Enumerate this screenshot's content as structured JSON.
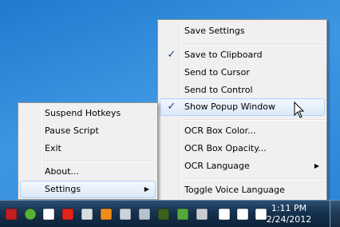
{
  "settings_menu": {
    "items": [
      {
        "label": "Save Settings",
        "checked": false
      },
      {
        "label": "Save to Clipboard",
        "checked": true
      },
      {
        "label": "Send to Cursor",
        "checked": false
      },
      {
        "label": "Send to Control",
        "checked": false
      },
      {
        "label": "Show Popup Window",
        "checked": true,
        "hovered": true
      },
      {
        "label": "OCR Box Color...",
        "checked": false
      },
      {
        "label": "OCR Box Opacity...",
        "checked": false
      },
      {
        "label": "OCR Language",
        "checked": false,
        "has_submenu": true
      },
      {
        "label": "Toggle Voice Language",
        "checked": false
      }
    ],
    "check_glyph": "✓",
    "arrow_glyph": "▶"
  },
  "script_menu": {
    "items": [
      {
        "label": "Suspend Hotkeys"
      },
      {
        "label": "Pause Script"
      },
      {
        "label": "Exit"
      },
      {
        "label": "About..."
      },
      {
        "label": "Settings",
        "has_submenu": true,
        "hovered": true
      }
    ]
  },
  "taskbar": {
    "clock_time": "1:11 PM",
    "clock_date": "2/24/2012",
    "tray_icons": [
      {
        "name": "autohotkey-tray-icon",
        "color": "#c21d24"
      },
      {
        "name": "utorrent-tray-icon",
        "color": "#57b337"
      },
      {
        "name": "windows-flag-tray-icon",
        "color": "#ffffff"
      },
      {
        "name": "red-stop-tray-icon",
        "color": "#e2231a"
      },
      {
        "name": "gmail-tray-icon",
        "color": "#d8dde3"
      },
      {
        "name": "orange-box-tray-icon",
        "color": "#f18b1c"
      },
      {
        "name": "email-tray-icon",
        "color": "#c9d3de"
      },
      {
        "name": "camera-tray-icon",
        "color": "#b7c2cf"
      },
      {
        "name": "chip-tray-icon",
        "color": "#3b5f1c"
      },
      {
        "name": "shield-tray-icon",
        "color": "#52a83a"
      },
      {
        "name": "monitor-tray-icon",
        "color": "#c7ccd1"
      },
      {
        "name": "action-center-flag-icon",
        "color": "#ffffff"
      },
      {
        "name": "network-icon",
        "color": "#ffffff"
      },
      {
        "name": "signal-bars-icon",
        "color": "#ffffff"
      },
      {
        "name": "volume-icon",
        "color": "#ffffff"
      }
    ]
  }
}
